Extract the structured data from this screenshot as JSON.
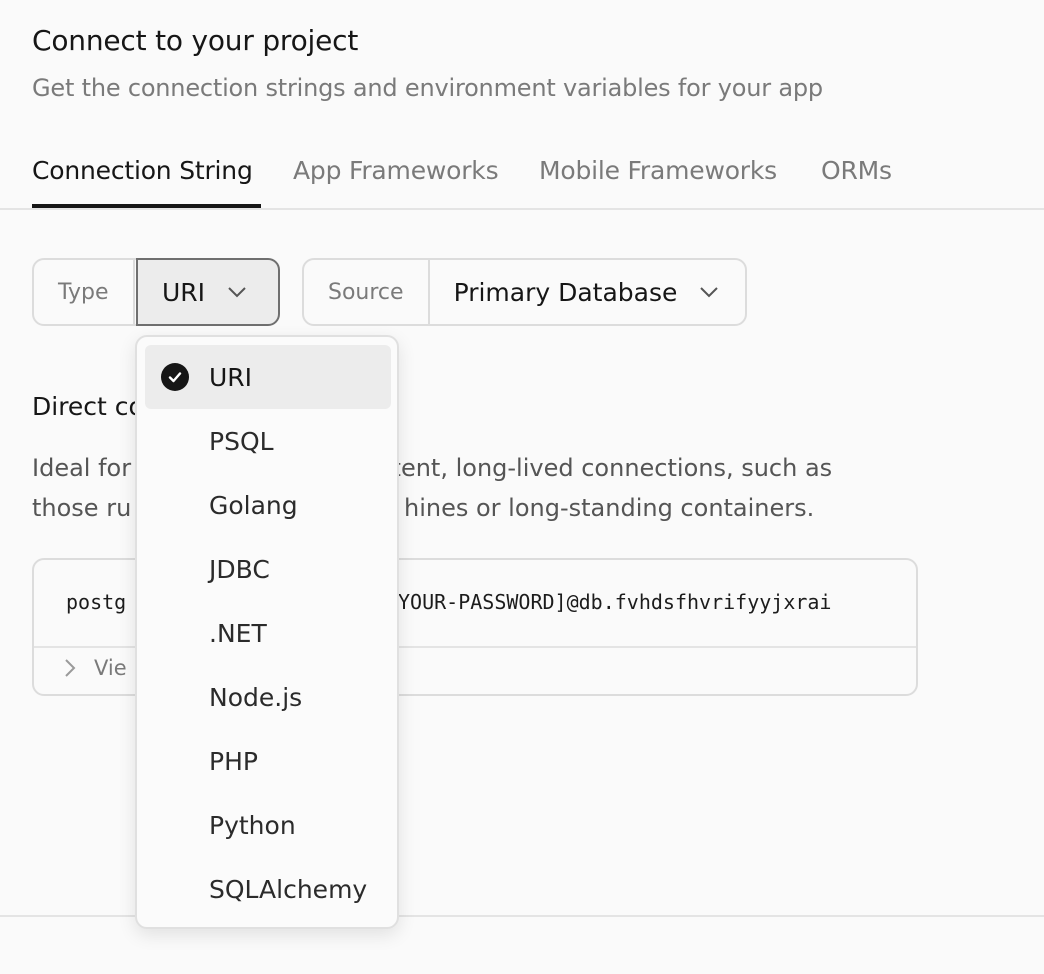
{
  "header": {
    "title": "Connect to your project",
    "subtitle": "Get the connection strings and environment variables for your app"
  },
  "tabs": [
    {
      "label": "Connection String",
      "active": true
    },
    {
      "label": "App Frameworks",
      "active": false
    },
    {
      "label": "Mobile Frameworks",
      "active": false
    },
    {
      "label": "ORMs",
      "active": false
    }
  ],
  "type_selector": {
    "label": "Type",
    "value": "URI"
  },
  "source_selector": {
    "label": "Source",
    "value": "Primary Database"
  },
  "section": {
    "title": "Direct co",
    "desc_line1_left": "Ideal for",
    "desc_line1_right": "rsistent, long-lived connections, such as",
    "desc_line2_left": "those ru",
    "desc_line2_right": "hines or long-standing containers."
  },
  "code": {
    "visible_left": "postg",
    "visible_right": "YOUR-PASSWORD]@db.fvhdsfhvrifyyjxrai",
    "view_label": "Vie"
  },
  "dropdown": {
    "options": [
      "URI",
      "PSQL",
      "Golang",
      "JDBC",
      ".NET",
      "Node.js",
      "PHP",
      "Python",
      "SQLAlchemy"
    ],
    "selected": "URI"
  },
  "icons": {
    "chevron": "chevron-down-icon",
    "check": "check-circle-icon",
    "expand": "chevron-right-icon"
  },
  "colors": {
    "text_primary": "#161616",
    "text_muted": "#7a7a7a",
    "border": "#dcdcdc",
    "selected_bg": "#ececec"
  }
}
